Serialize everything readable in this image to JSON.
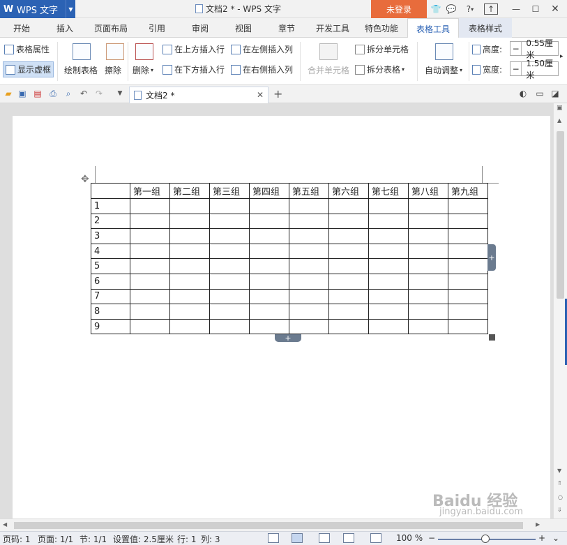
{
  "app": {
    "logo_glyph": "W",
    "name": "WPS 文字",
    "window_title": "文档2 * - WPS 文字",
    "login_label": "未登录",
    "help_label": "?"
  },
  "tabs": [
    "开始",
    "插入",
    "页面布局",
    "引用",
    "审阅",
    "视图",
    "章节",
    "开发工具",
    "特色功能",
    "表格工具",
    "表格样式"
  ],
  "ribbon": {
    "table_props": "表格属性",
    "show_gridlines": "显示虚框",
    "draw_table": "绘制表格",
    "erase": "擦除",
    "delete": "删除",
    "insert_row_above": "在上方插入行",
    "insert_row_below": "在下方插入行",
    "insert_col_left": "在左侧插入列",
    "insert_col_right": "在右侧插入列",
    "merge_cells": "合并单元格",
    "split_cells": "拆分单元格",
    "split_table": "拆分表格",
    "auto_fit": "自动调整",
    "height_label": "高度:",
    "height_value": "0.55厘米",
    "width_label": "宽度:",
    "width_value": "1.50厘米"
  },
  "doc_tab": {
    "title": "文档2 *"
  },
  "table": {
    "headers": [
      "",
      "第一组",
      "第二组",
      "第三组",
      "第四组",
      "第五组",
      "第六组",
      "第七组",
      "第八组",
      "第九组"
    ],
    "rows": [
      "1",
      "2",
      "3",
      "4",
      "5",
      "6",
      "7",
      "8",
      "9"
    ]
  },
  "status": {
    "page_no": "页码: 1",
    "pages": "页面: 1/1",
    "section": "节: 1/1",
    "set_value": "设置值: 2.5厘米",
    "row": "行: 1",
    "col": "列: 3",
    "zoom": "100 %"
  },
  "watermark": {
    "brand": "Baidu 经验",
    "url": "jingyan.baidu.com"
  },
  "colors": {
    "brand_blue": "#2b62b4",
    "login_orange": "#e86c3c"
  }
}
